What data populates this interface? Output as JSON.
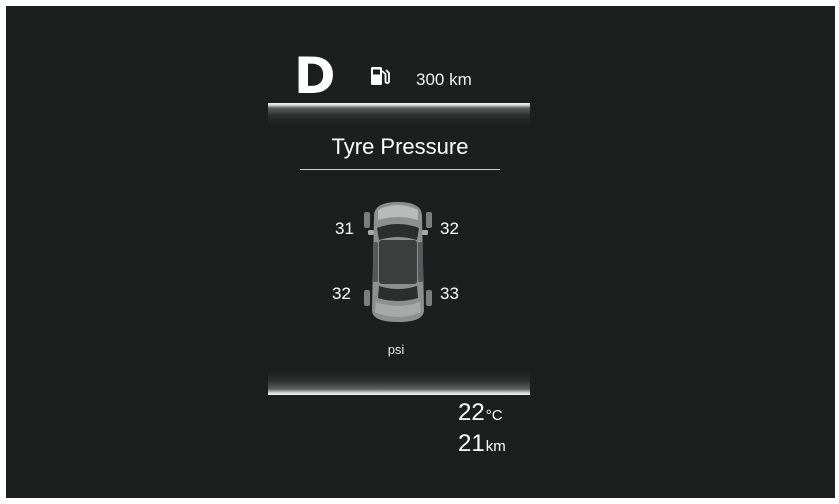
{
  "status": {
    "gear": "D",
    "fuel_icon": "fuel-pump-icon",
    "range": "300 km"
  },
  "tpms": {
    "title": "Tyre Pressure",
    "front_left": "31",
    "front_right": "32",
    "rear_left": "32",
    "rear_right": "33",
    "unit": "psi",
    "car_icon": "car-top-view-icon"
  },
  "footer": {
    "temperature_value": "22",
    "temperature_unit": "°C",
    "trip_value": "21",
    "trip_unit": "km"
  },
  "colors": {
    "background": "#1b201f",
    "text": "#ffffff"
  }
}
